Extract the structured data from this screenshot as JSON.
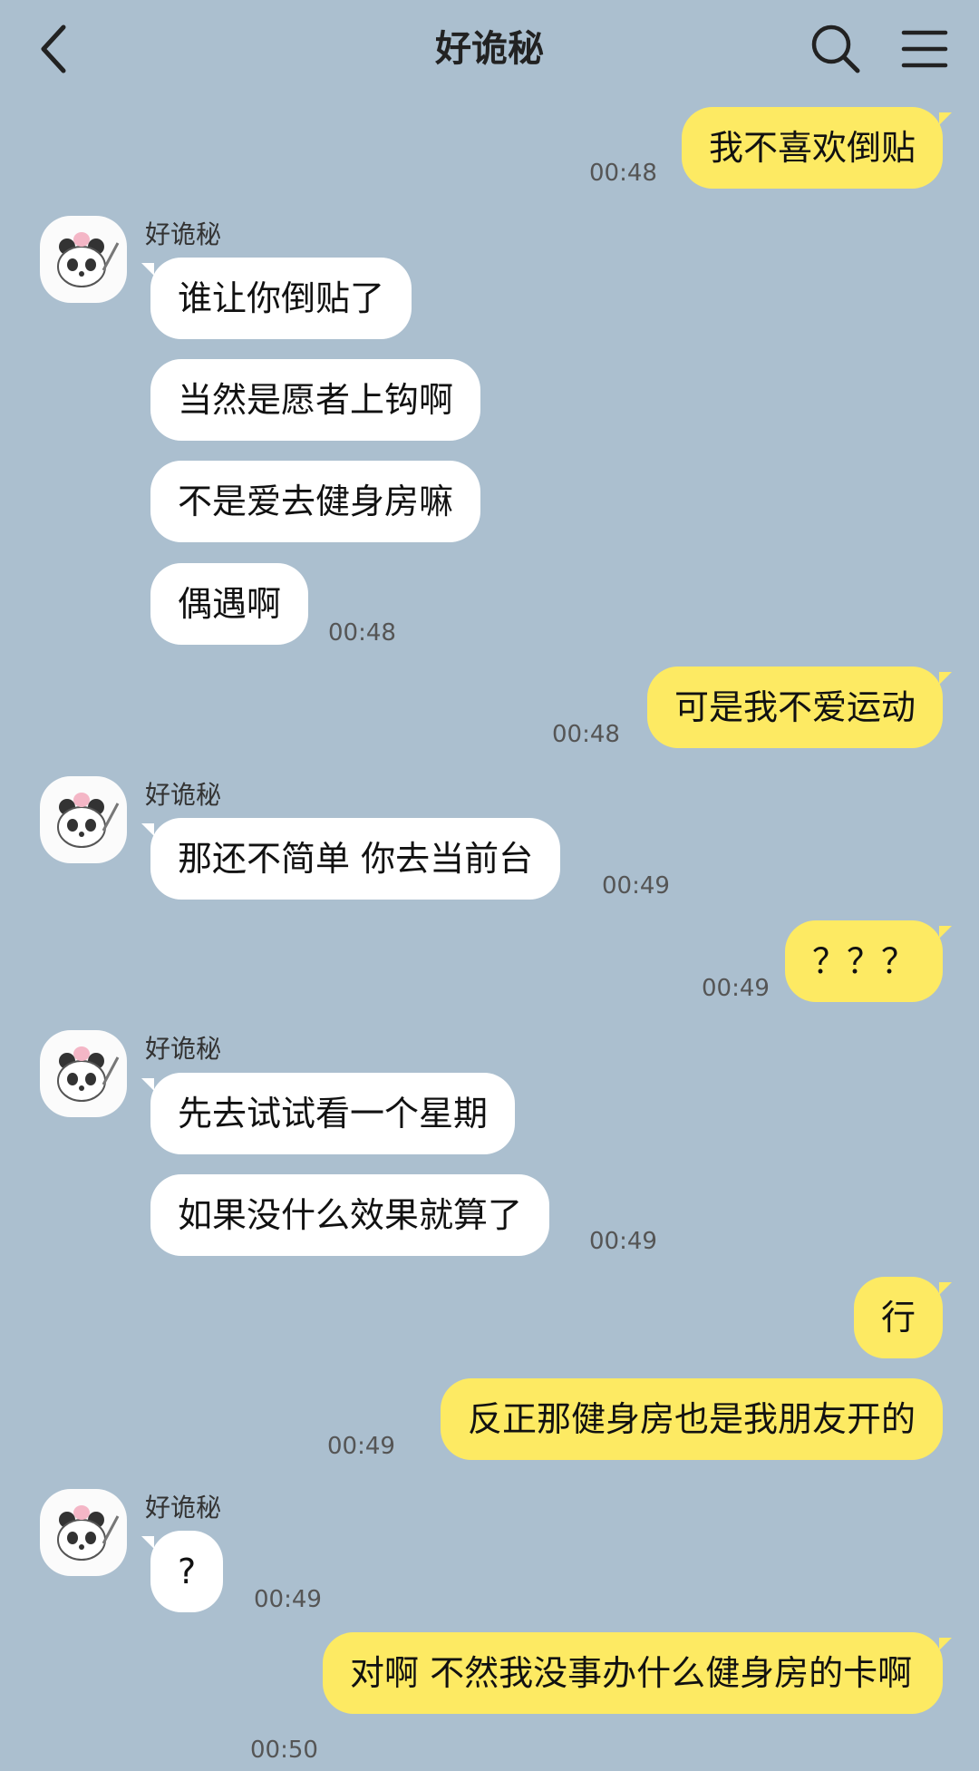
{
  "header": {
    "title": "好诡秘"
  },
  "contact": {
    "name": "好诡秘",
    "avatar_icon": "panda-avatar-icon"
  },
  "messages": [
    {
      "from": "me",
      "text": "我不喜欢倒贴",
      "time": "00:48"
    },
    {
      "from": "them",
      "sender": "好诡秘",
      "text": "谁让你倒贴了",
      "time": ""
    },
    {
      "from": "them",
      "text": "当然是愿者上钩啊",
      "time": ""
    },
    {
      "from": "them",
      "text": "不是爱去健身房嘛",
      "time": ""
    },
    {
      "from": "them",
      "text": "偶遇啊",
      "time": "00:48"
    },
    {
      "from": "me",
      "text": "可是我不爱运动",
      "time": "00:48"
    },
    {
      "from": "them",
      "sender": "好诡秘",
      "text": "那还不简单 你去当前台",
      "time": "00:49"
    },
    {
      "from": "me",
      "text": "？？？",
      "time": "00:49"
    },
    {
      "from": "them",
      "sender": "好诡秘",
      "text": "先去试试看一个星期",
      "time": ""
    },
    {
      "from": "them",
      "text": "如果没什么效果就算了",
      "time": "00:49"
    },
    {
      "from": "me",
      "text": "行",
      "time": ""
    },
    {
      "from": "me",
      "text": "反正那健身房也是我朋友开的",
      "time": "00:49"
    },
    {
      "from": "them",
      "sender": "好诡秘",
      "text": "?",
      "time": "00:49"
    },
    {
      "from": "me",
      "text": "对啊   不然我没事办什么健身房的卡啊",
      "time": "00:50"
    }
  ],
  "colors": {
    "background": "#abbfcf",
    "outgoing_bubble": "#fdea63",
    "incoming_bubble": "#ffffff"
  }
}
